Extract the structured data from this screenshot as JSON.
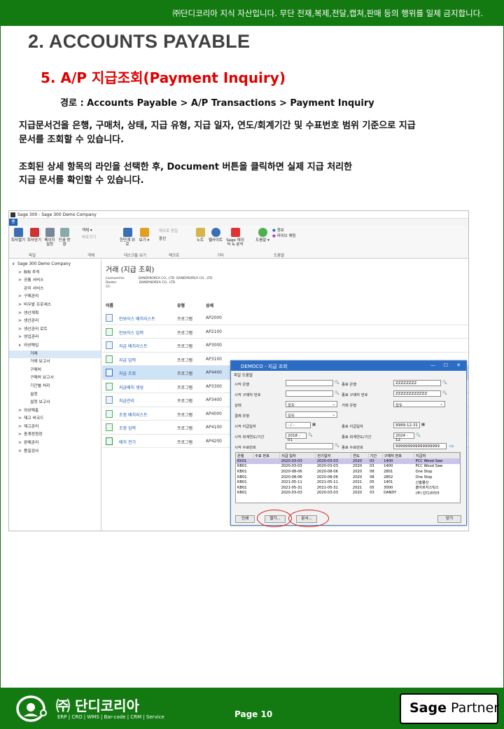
{
  "header": {
    "notice": "㈜단디코리아 지식 자산입니다. 무단 전재,복제,전달,캡쳐,판매 등의 행위를 일체 금지합니다."
  },
  "section_title": "2. ACCOUNTS PAYABLE",
  "subsection_title": "5. A/P 지급조회(Payment Inquiry)",
  "path": "경로 : Accounts Payable > A/P Transactions > Payment Inquiry",
  "paragraphs": [
    "지급문서건을 은행, 구매처, 상태, 지급 유형, 지급 일자, 연도/회계기간 및 수표번호 범위 기준으로 지급",
    "문서를 조회할 수 있습니다.",
    "조회된 상세 항목의 라인을 선택한 후, Document 버튼을 클릭하면 실제 지급 처리한",
    "지급 문서를 확인할 수 있습니다."
  ],
  "app": {
    "window_title": "Sage 300 - Sage 300 Demo Company",
    "ribbon_tab": "홈",
    "ribbon_buttons": [
      "회사열기",
      "회사닫기",
      "페이지 설정",
      "인쇄 방향",
      "객체",
      "바로가기",
      "한단계 위로",
      "보기",
      "매크로 편집",
      "중선",
      "노트",
      "웹사이트",
      "Sage 데이터 & 분석",
      "도움말",
      "정보",
      "라이브 채팅"
    ],
    "ribbon_groups": [
      "파일",
      "객체",
      "데스크톱 보기",
      "매크로",
      "기타",
      "도움말"
    ],
    "tree": [
      {
        "label": "Sage 300 Demo Company",
        "level": 0,
        "arrow": "∨"
      },
      {
        "label": "BIN 추적",
        "level": 1,
        "arrow": ">"
      },
      {
        "label": "공통 서비스",
        "level": 1,
        "arrow": ">"
      },
      {
        "label": "관리 서비스",
        "level": 1,
        "arrow": ""
      },
      {
        "label": "구매관리",
        "level": 1,
        "arrow": ">"
      },
      {
        "label": "비우발 프로세스",
        "level": 1,
        "arrow": ">"
      },
      {
        "label": "생산계획",
        "level": 1,
        "arrow": ">"
      },
      {
        "label": "생산관리",
        "level": 1,
        "arrow": ">"
      },
      {
        "label": "생산관리 로트",
        "level": 1,
        "arrow": ">"
      },
      {
        "label": "영업관리",
        "level": 1,
        "arrow": ">"
      },
      {
        "label": "외상매입",
        "level": 1,
        "arrow": "∨"
      },
      {
        "label": "거래",
        "level": 2,
        "arrow": "",
        "selected": true
      },
      {
        "label": "거래 보고서",
        "level": 2,
        "arrow": ""
      },
      {
        "label": "구매처",
        "level": 2,
        "arrow": ""
      },
      {
        "label": "구매처 보고서",
        "level": 2,
        "arrow": ""
      },
      {
        "label": "기간별 처리",
        "level": 2,
        "arrow": ""
      },
      {
        "label": "설정",
        "level": 2,
        "arrow": ""
      },
      {
        "label": "설정 보고서",
        "level": 2,
        "arrow": ""
      },
      {
        "label": "외상매출",
        "level": 1,
        "arrow": ">"
      },
      {
        "label": "재고 바코드",
        "level": 1,
        "arrow": ">"
      },
      {
        "label": "재고관리",
        "level": 1,
        "arrow": ">"
      },
      {
        "label": "총계정원장",
        "level": 1,
        "arrow": ">"
      },
      {
        "label": "판매관리",
        "level": 1,
        "arrow": ">"
      },
      {
        "label": "품질검사",
        "level": 1,
        "arrow": ">"
      }
    ],
    "main": {
      "title": "거래 (지급 조회)",
      "license_lines": [
        "Licensed to:",
        "Dealer:",
        "CC:"
      ],
      "license_values": [
        "DANDYKOREA CO., LTD. DANDYKOREA CO., LTD",
        "DANDYKOREA CO., LTD",
        ""
      ],
      "columns": [
        "이름",
        "유형",
        "상세"
      ],
      "rows": [
        {
          "name": "인보이스 배치리스트",
          "type": "프로그램",
          "code": "AP2000"
        },
        {
          "name": "인보이스 입력",
          "type": "프로그램",
          "code": "AP2100"
        },
        {
          "name": "지급 배치리스트",
          "type": "프로그램",
          "code": "AP3000"
        },
        {
          "name": "지급 입력",
          "type": "프로그램",
          "code": "AP3100"
        },
        {
          "name": "지급 조회",
          "type": "프로그램",
          "code": "AP4400",
          "selected": true
        },
        {
          "name": "지급배치 생성",
          "type": "프로그램",
          "code": "AP3300"
        },
        {
          "name": "지급관리",
          "type": "프로그램",
          "code": "AP3400"
        },
        {
          "name": "조정 배치리스트",
          "type": "프로그램",
          "code": "AP4000"
        },
        {
          "name": "조정 입력",
          "type": "프로그램",
          "code": "AP4100"
        },
        {
          "name": "배치 전기",
          "type": "프로그램",
          "code": "AP4200"
        }
      ]
    },
    "dialog": {
      "title": "DEMOCO - 지급 조회",
      "menu": "파일 도움말",
      "labels": {
        "from_bank": "시작 은행",
        "to_bank": "종료 은행",
        "from_vendor": "시작 구매처 번호",
        "to_vendor": "종료 구매처 번호",
        "status": "상태",
        "txn_type": "거래 유형",
        "pay_type": "결제 유형",
        "from_date": "시작 지급일자",
        "to_date": "종료 지급일자",
        "from_period": "시작 회계연도/기간",
        "to_period": "종료 회계연도/기간",
        "from_check": "시작 수표번호",
        "to_check": "종료 수표번호"
      },
      "values": {
        "from_bank": "",
        "to_bank": "ZZZZZZZZ",
        "from_vendor": "",
        "to_vendor": "ZZZZZZZZZZZZ",
        "status": "모두",
        "txn_type": "모두",
        "pay_type": "모두",
        "from_date": "- / -",
        "to_date": "9999-12-31",
        "from_period": "2018 - 01",
        "to_period": "2024 - 12",
        "from_check": "",
        "to_check": "999999999999999999"
      },
      "grid_columns": [
        "은행",
        "수표 번호",
        "지급 일자",
        "전기일자",
        "연도",
        "기간",
        "구매처 번호",
        "지급처"
      ],
      "grid_rows": [
        [
          "EK01",
          "",
          "2020-03-03",
          "2020-03-03",
          "2020",
          "03",
          "1400",
          "PCC Wood Saw"
        ],
        [
          "KB01",
          "",
          "2020-03-03",
          "2020-03-03",
          "2020",
          "03",
          "1400",
          "PCC Wood Saw"
        ],
        [
          "KB01",
          "",
          "2020-08-06",
          "2020-08-06",
          "2020",
          "08",
          "2801",
          "One Stop"
        ],
        [
          "KB01",
          "",
          "2020-08-06",
          "2020-08-06",
          "2020",
          "08",
          "2802",
          "One Stop"
        ],
        [
          "KB01",
          "",
          "2021-05-11",
          "2021-05-11",
          "2021",
          "05",
          "1401",
          "신흥물산"
        ],
        [
          "KB01",
          "",
          "2021-05-31",
          "2021-05-31",
          "2021",
          "05",
          "3000",
          "솔아르지스틱스"
        ],
        [
          "KB01",
          "",
          "2020-03-03",
          "2020-03-03",
          "2020",
          "03",
          "DANDY",
          "(주) 단디코리아"
        ]
      ],
      "buttons": {
        "print": "인쇄",
        "open": "열기...",
        "document": "문서...",
        "close": "닫기"
      }
    }
  },
  "footer": {
    "company": "㈜ 단디코리아",
    "tagline": "ERP | CRO | WMS | Bar-code | CRM | Service",
    "page": "Page 10",
    "partner_brand": "Sage",
    "partner_label": "Partner"
  },
  "colors": {
    "brand_green": "#137a12",
    "title_red": "#e00000",
    "dialog_blue": "#2b6cc4"
  }
}
